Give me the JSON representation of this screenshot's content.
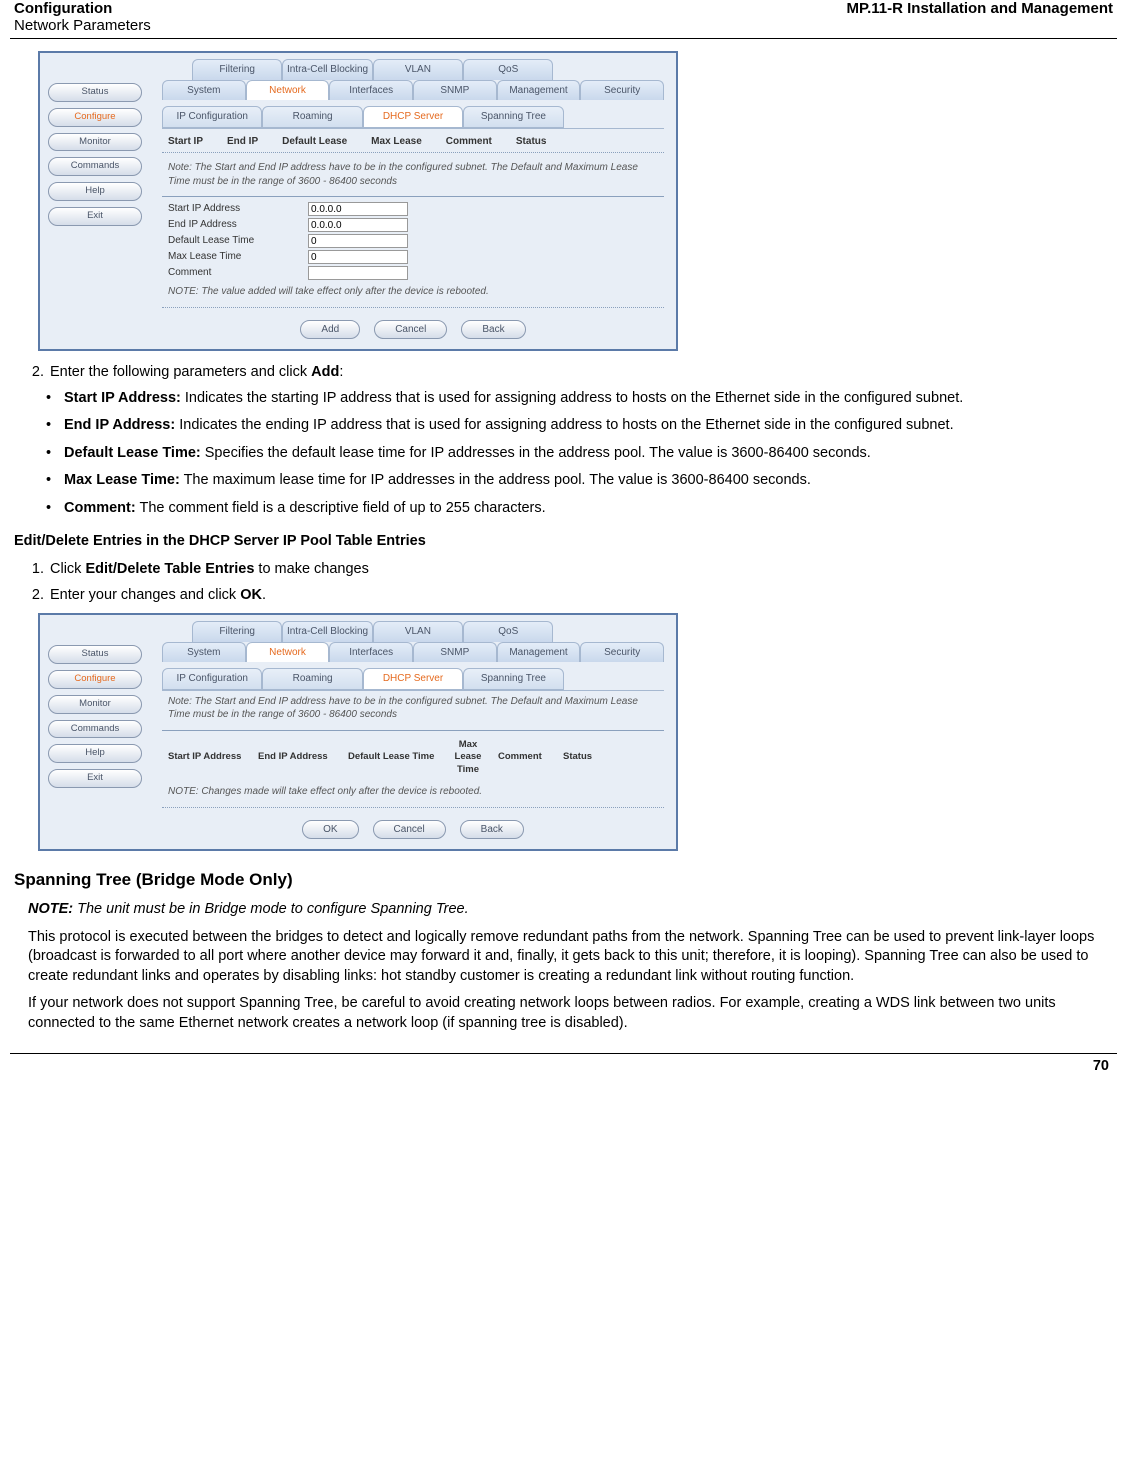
{
  "header": {
    "left_title": "Configuration",
    "left_sub": "Network Parameters",
    "right": "MP.11-R Installation and Management"
  },
  "page_number": "70",
  "screenshot1": {
    "nav": [
      "Status",
      "Configure",
      "Monitor",
      "Commands",
      "Help",
      "Exit"
    ],
    "tabs_row1": [
      "Filtering",
      "Intra-Cell Blocking",
      "VLAN",
      "QoS"
    ],
    "tabs_row2": [
      "System",
      "Network",
      "Interfaces",
      "SNMP",
      "Management",
      "Security"
    ],
    "subtabs": [
      "IP Configuration",
      "Roaming",
      "DHCP Server",
      "Spanning Tree"
    ],
    "headers": [
      "Start IP",
      "End IP",
      "Default Lease",
      "Max Lease",
      "Comment",
      "Status"
    ],
    "note": "Note: The Start and End IP address have to be in the configured subnet. The Default and Maximum Lease Time must be in the range of 3600 - 86400 seconds",
    "fields": {
      "start_ip": {
        "label": "Start IP Address",
        "value": "0.0.0.0"
      },
      "end_ip": {
        "label": "End IP Address",
        "value": "0.0.0.0"
      },
      "default_lease": {
        "label": "Default Lease Time",
        "value": "0"
      },
      "max_lease": {
        "label": "Max Lease Time",
        "value": "0"
      },
      "comment": {
        "label": "Comment",
        "value": ""
      }
    },
    "note2": "NOTE: The value added will take effect only after the device is rebooted.",
    "buttons": [
      "Add",
      "Cancel",
      "Back"
    ]
  },
  "step2": {
    "text_pre": "Enter the following parameters and click ",
    "bold": "Add",
    "text_post": ":"
  },
  "bullets": [
    {
      "b": "Start IP Address:",
      "t": " Indicates the starting IP address that is used for assigning address to hosts on the Ethernet side in the configured subnet."
    },
    {
      "b": "End IP Address:",
      "t": " Indicates the ending IP address that is used for assigning address to hosts on the Ethernet side in the configured subnet."
    },
    {
      "b": "Default Lease Time:",
      "t": " Specifies the default lease time for IP addresses in the address pool. The value is 3600-86400 seconds."
    },
    {
      "b": "Max Lease Time:",
      "t": " The maximum lease time for IP addresses in the address pool. The value is 3600-86400 seconds."
    },
    {
      "b": "Comment:",
      "t": " The comment field is a descriptive field of up to 255 characters."
    }
  ],
  "edit_section": {
    "heading": "Edit/Delete Entries in the DHCP Server IP Pool Table Entries",
    "step1_pre": "Click ",
    "step1_b": "Edit/Delete Table Entries",
    "step1_post": " to make changes",
    "step2_pre": "Enter your changes and click ",
    "step2_b": "OK",
    "step2_post": "."
  },
  "screenshot2": {
    "nav": [
      "Status",
      "Configure",
      "Monitor",
      "Commands",
      "Help",
      "Exit"
    ],
    "tabs_row1": [
      "Filtering",
      "Intra-Cell Blocking",
      "VLAN",
      "QoS"
    ],
    "tabs_row2": [
      "System",
      "Network",
      "Interfaces",
      "SNMP",
      "Management",
      "Security"
    ],
    "subtabs": [
      "IP Configuration",
      "Roaming",
      "DHCP Server",
      "Spanning Tree"
    ],
    "note": "Note: The Start and End IP address have to be in the configured subnet. The Default and Maximum Lease Time must be in the range of 3600 - 86400 seconds",
    "headers": [
      "Start IP Address",
      "End IP Address",
      "Default Lease Time",
      "Max Lease Time",
      "Comment",
      "Status"
    ],
    "note2": "NOTE: Changes made will take effect only after the device is rebooted.",
    "buttons": [
      "OK",
      "Cancel",
      "Back"
    ]
  },
  "spanning": {
    "heading": "Spanning Tree (Bridge Mode Only)",
    "note_label": "NOTE:",
    "note_text": " The unit must be in Bridge mode to configure Spanning Tree.",
    "p1": "This protocol is executed between the bridges to detect and logically remove redundant paths from the network. Spanning Tree can be used to prevent link-layer loops (broadcast is forwarded to all port where another device may forward it and, finally, it gets back to this unit; therefore, it is looping). Spanning Tree can also be used to create redundant links and operates by disabling links: hot standby customer is creating a redundant link without routing function.",
    "p2": "If your network does not support Spanning Tree, be careful to avoid creating network loops between radios. For example, creating a WDS link between two units connected to the same Ethernet network creates a network loop (if spanning tree is disabled)."
  }
}
